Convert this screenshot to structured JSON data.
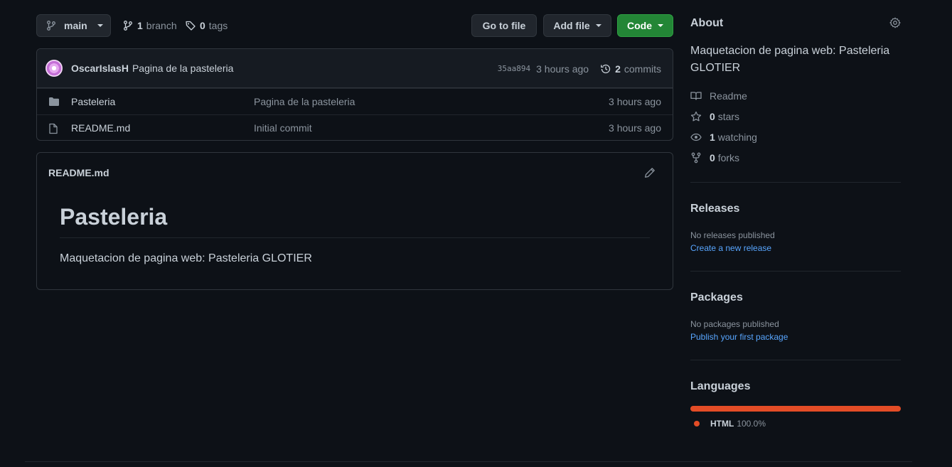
{
  "colors": {
    "background": "#0d1117",
    "border": "#30363d",
    "accent_green": "#238636",
    "link": "#58a6ff",
    "html_lang": "#e34c26"
  },
  "toolbar": {
    "branch_label": "main",
    "branches_count": "1",
    "branches_label": "branch",
    "tags_count": "0",
    "tags_label": "tags",
    "goto_label": "Go to file",
    "addfile_label": "Add file",
    "code_label": "Code"
  },
  "commit": {
    "author": "OscarIslasH",
    "message": "Pagina de la pasteleria",
    "sha": "35aa894",
    "age": "3 hours ago",
    "commits_count": "2",
    "commits_label": "commits"
  },
  "files": [
    {
      "icon": "folder-icon",
      "name": "Pasteleria",
      "commit": "Pagina de la pasteleria",
      "age": "3 hours ago"
    },
    {
      "icon": "file-icon",
      "name": "README.md",
      "commit": "Initial commit",
      "age": "3 hours ago"
    }
  ],
  "readme": {
    "filename": "README.md",
    "heading": "Pasteleria",
    "body": "Maquetacion de pagina web: Pasteleria GLOTIER"
  },
  "about": {
    "title": "About",
    "description": "Maquetacion de pagina web: Pasteleria GLOTIER",
    "readme_label": "Readme",
    "stars_count": "0",
    "stars_label": "stars",
    "watching_count": "1",
    "watching_label": "watching",
    "forks_count": "0",
    "forks_label": "forks"
  },
  "releases": {
    "title": "Releases",
    "empty": "No releases published",
    "link": "Create a new release"
  },
  "packages": {
    "title": "Packages",
    "empty": "No packages published",
    "link": "Publish your first package"
  },
  "languages": {
    "title": "Languages",
    "items": [
      {
        "name": "HTML",
        "percent": "100.0%"
      }
    ]
  }
}
